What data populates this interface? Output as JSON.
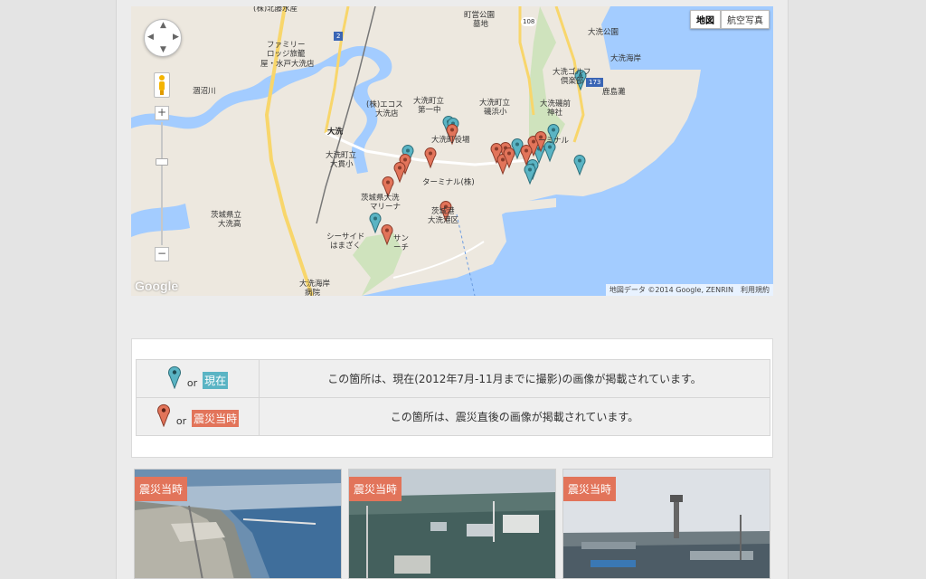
{
  "map": {
    "map_type_buttons": [
      "地図",
      "航空写真"
    ],
    "credit": "地図データ ©2014 Google, ZENRIN",
    "terms": "利用規約",
    "google_logo": "Google",
    "zoom_in": "+",
    "zoom_out": "−",
    "labels": [
      "(株)北藤水産",
      "町営公園",
      "墓地",
      "108",
      "大洗公園",
      "大洗海岸",
      "ファミリー",
      "ロッジ旅籠",
      "屋・水戸大洗店",
      "大洗ゴルフ",
      "倶楽部",
      "鹿島灘",
      "涸沼川",
      "(株)エコス",
      "大洗店",
      "大洗町立",
      "第一中",
      "大洗町立",
      "磯浜小",
      "大洗磯前",
      "神社",
      "大洗",
      "大洗町立",
      "大貫小",
      "大洗町役場",
      "ーミナル",
      "茨城県立",
      "大洗高",
      "茨城県大洗",
      "マリーナ",
      "ターミナル(株)",
      "茨城港",
      "大洗港区",
      "シーサイド",
      "はまざく",
      "サン",
      "ーチ",
      "大洗海岸",
      "病院",
      "2",
      "173"
    ],
    "markers": [
      {
        "color": "teal"
      },
      {
        "color": "teal"
      },
      {
        "color": "teal"
      },
      {
        "color": "teal"
      },
      {
        "color": "teal"
      },
      {
        "color": "teal"
      },
      {
        "color": "teal"
      },
      {
        "color": "teal"
      },
      {
        "color": "teal"
      },
      {
        "color": "teal"
      },
      {
        "color": "teal"
      },
      {
        "color": "teal"
      },
      {
        "color": "red"
      },
      {
        "color": "red"
      },
      {
        "color": "red"
      },
      {
        "color": "red"
      },
      {
        "color": "red"
      },
      {
        "color": "red"
      },
      {
        "color": "red"
      },
      {
        "color": "red"
      },
      {
        "color": "red"
      },
      {
        "color": "red"
      },
      {
        "color": "red"
      },
      {
        "color": "red"
      },
      {
        "color": "red"
      },
      {
        "color": "red"
      }
    ]
  },
  "legend": {
    "rows": [
      {
        "or": "or",
        "badge": "現在",
        "description": "この箇所は、現在(2012年7月-11月までに撮影)の画像が掲載されています。",
        "marker_color": "#5ab4c4"
      },
      {
        "or": "or",
        "badge": "震災当時",
        "description": "この箇所は、震災直後の画像が掲載されています。",
        "marker_color": "#e2745a"
      }
    ]
  },
  "thumbnails": [
    {
      "badge": "震災当時",
      "subject": "aerial-harbor"
    },
    {
      "badge": "震災当時",
      "subject": "flooded-port"
    },
    {
      "badge": "震災当時",
      "subject": "flooded-terminal-tower"
    }
  ],
  "colors": {
    "marker_current": "#5ab4c4",
    "marker_disaster": "#e2745a",
    "sea": "#a3ccff",
    "river": "#a3ccff",
    "land": "#ede8df",
    "major_road": "#f8d66b"
  }
}
